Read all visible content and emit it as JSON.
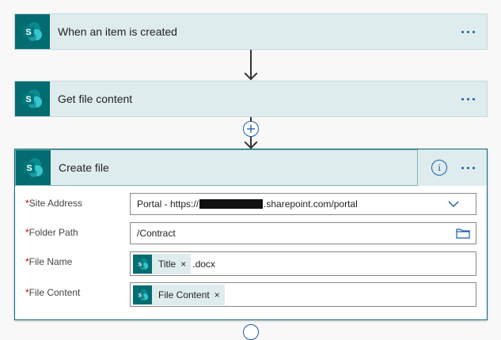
{
  "steps": {
    "trigger": {
      "title": "When an item is created"
    },
    "get_file": {
      "title": "Get file content"
    },
    "create_file": {
      "title": "Create file",
      "info_glyph": "i"
    }
  },
  "fields": {
    "site_address": {
      "required_mark": "*",
      "label": "Site Address",
      "value_prefix": "Portal - https://",
      "value_suffix": ".sharepoint.com/portal"
    },
    "folder_path": {
      "required_mark": "*",
      "label": "Folder Path",
      "value": "/Contract"
    },
    "file_name": {
      "required_mark": "*",
      "label": "File Name",
      "token": "Title",
      "token_remove": "×",
      "suffix": ".docx"
    },
    "file_content": {
      "required_mark": "*",
      "label": "File Content",
      "token": "File Content",
      "token_remove": "×"
    }
  },
  "icons": {
    "sharepoint": "sharepoint-icon",
    "more": "more-options-icon",
    "add": "add-step-icon",
    "info": "info-icon",
    "dropdown": "chevron-down-icon",
    "folder": "folder-icon"
  },
  "colors": {
    "sharepoint_teal": "#036c70",
    "card_bg": "#dfecee",
    "accent_blue": "#1a5dab",
    "required_red": "#cc0000"
  }
}
